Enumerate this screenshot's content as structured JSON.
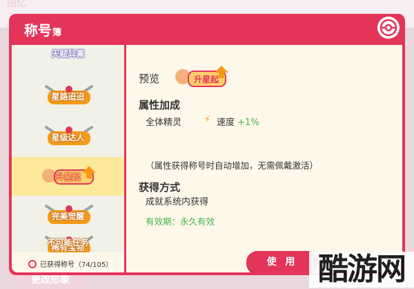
{
  "background": {
    "faded_text": "回忆",
    "bottom_button": "更改形象"
  },
  "dialog": {
    "title": "称号",
    "title_suffix": "簿"
  },
  "badges": [
    {
      "text": "天赋异禀",
      "style": "blue"
    },
    {
      "text": "星路迢迢",
      "style": "gold"
    },
    {
      "text": "星级达人",
      "style": "gold"
    },
    {
      "text": "升星起",
      "style": "pink",
      "selected": true
    },
    {
      "text": "完美觉醒",
      "style": "gold"
    },
    {
      "text": "稀有宝物",
      "style": "gold"
    },
    {
      "text": "不可能任务",
      "style": "gold"
    }
  ],
  "owned": {
    "label": "已获得称号",
    "count": "（74/105）"
  },
  "detail": {
    "preview_label": "预览",
    "preview_badge": "升星起",
    "attr_title": "属性加成",
    "attr_target": "全体精灵",
    "attr_name": "速度",
    "attr_value": "+1%",
    "note": "（属性获得称号时自动增加，无需佩戴激活）",
    "obtain_title": "获得方式",
    "obtain_text": "成就系统内获得",
    "validity_label": "有效期：",
    "validity_value": "永久有效",
    "use_button": "使 用"
  },
  "watermark": "酷游网",
  "colors": {
    "accent": "#e3345a",
    "panel": "#fdf8ea",
    "selected": "#fde99a",
    "green": "#47b34c"
  }
}
